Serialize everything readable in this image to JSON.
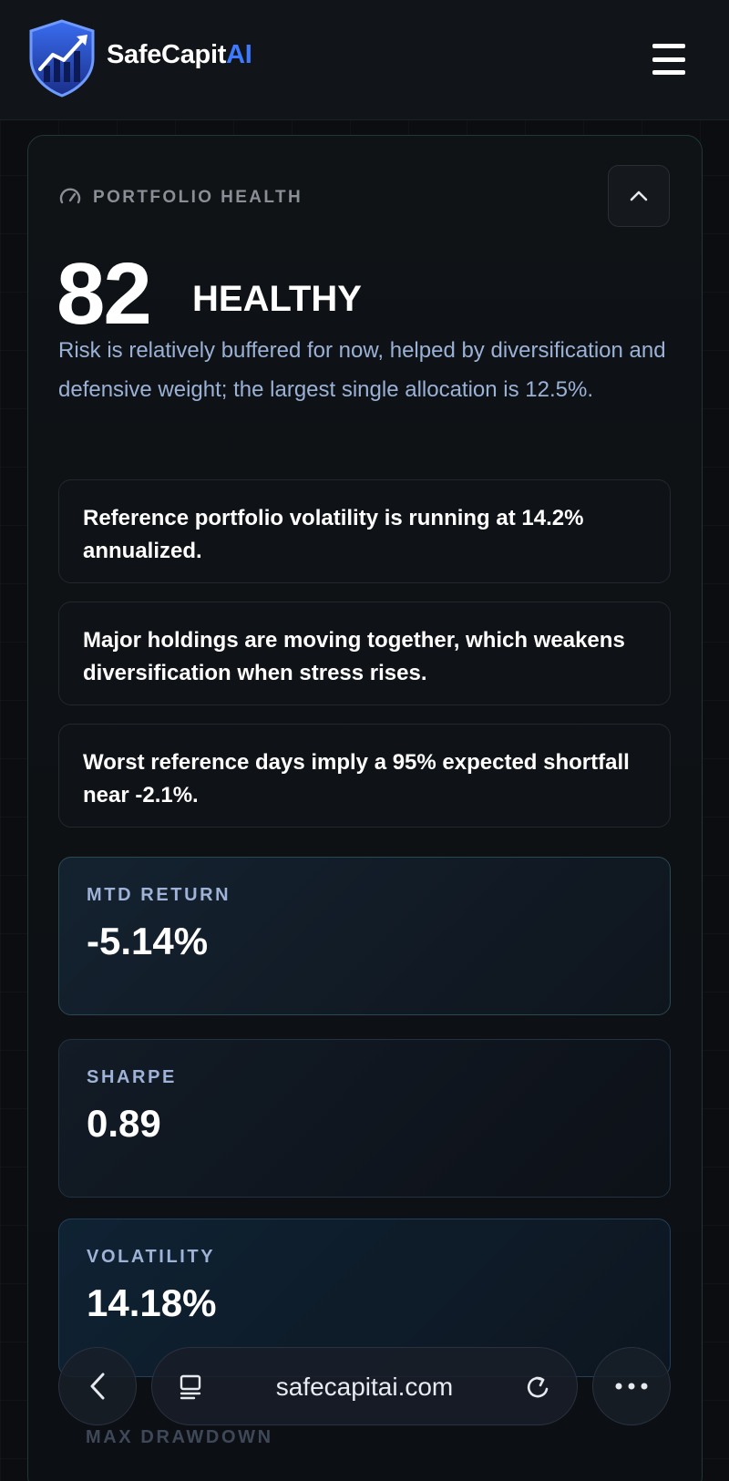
{
  "header": {
    "brand_prefix": "SafeCapit",
    "brand_suffix": "AI",
    "brand_accent": "#3c7bff"
  },
  "health": {
    "section_label": "PORTFOLIO HEALTH",
    "score": "82",
    "status": "HEALTHY",
    "summary": "Risk is relatively buffered for now, helped by diversification and defensive weight; the largest single allocation is 12.5%."
  },
  "insights": [
    "Reference portfolio volatility is running at 14.2% annualized.",
    "Major holdings are moving together, which weakens diversification when stress rises.",
    "Worst reference days imply a 95% expected shortfall near -2.1%."
  ],
  "metrics": [
    {
      "label": "MTD RETURN",
      "value": "-5.14%"
    },
    {
      "label": "SHARPE",
      "value": "0.89"
    },
    {
      "label": "VOLATILITY",
      "value": "14.18%"
    },
    {
      "label": "MAX DRAWDOWN",
      "value": ""
    }
  ],
  "browser": {
    "url": "safecapitai.com",
    "icons": [
      "chevron-left-icon",
      "reader-icon",
      "reload-icon",
      "more-icon"
    ]
  },
  "colors": {
    "background": "#0b0d11",
    "summary_text": "#9bb1d6",
    "metric_label": "#9fb3d8"
  }
}
